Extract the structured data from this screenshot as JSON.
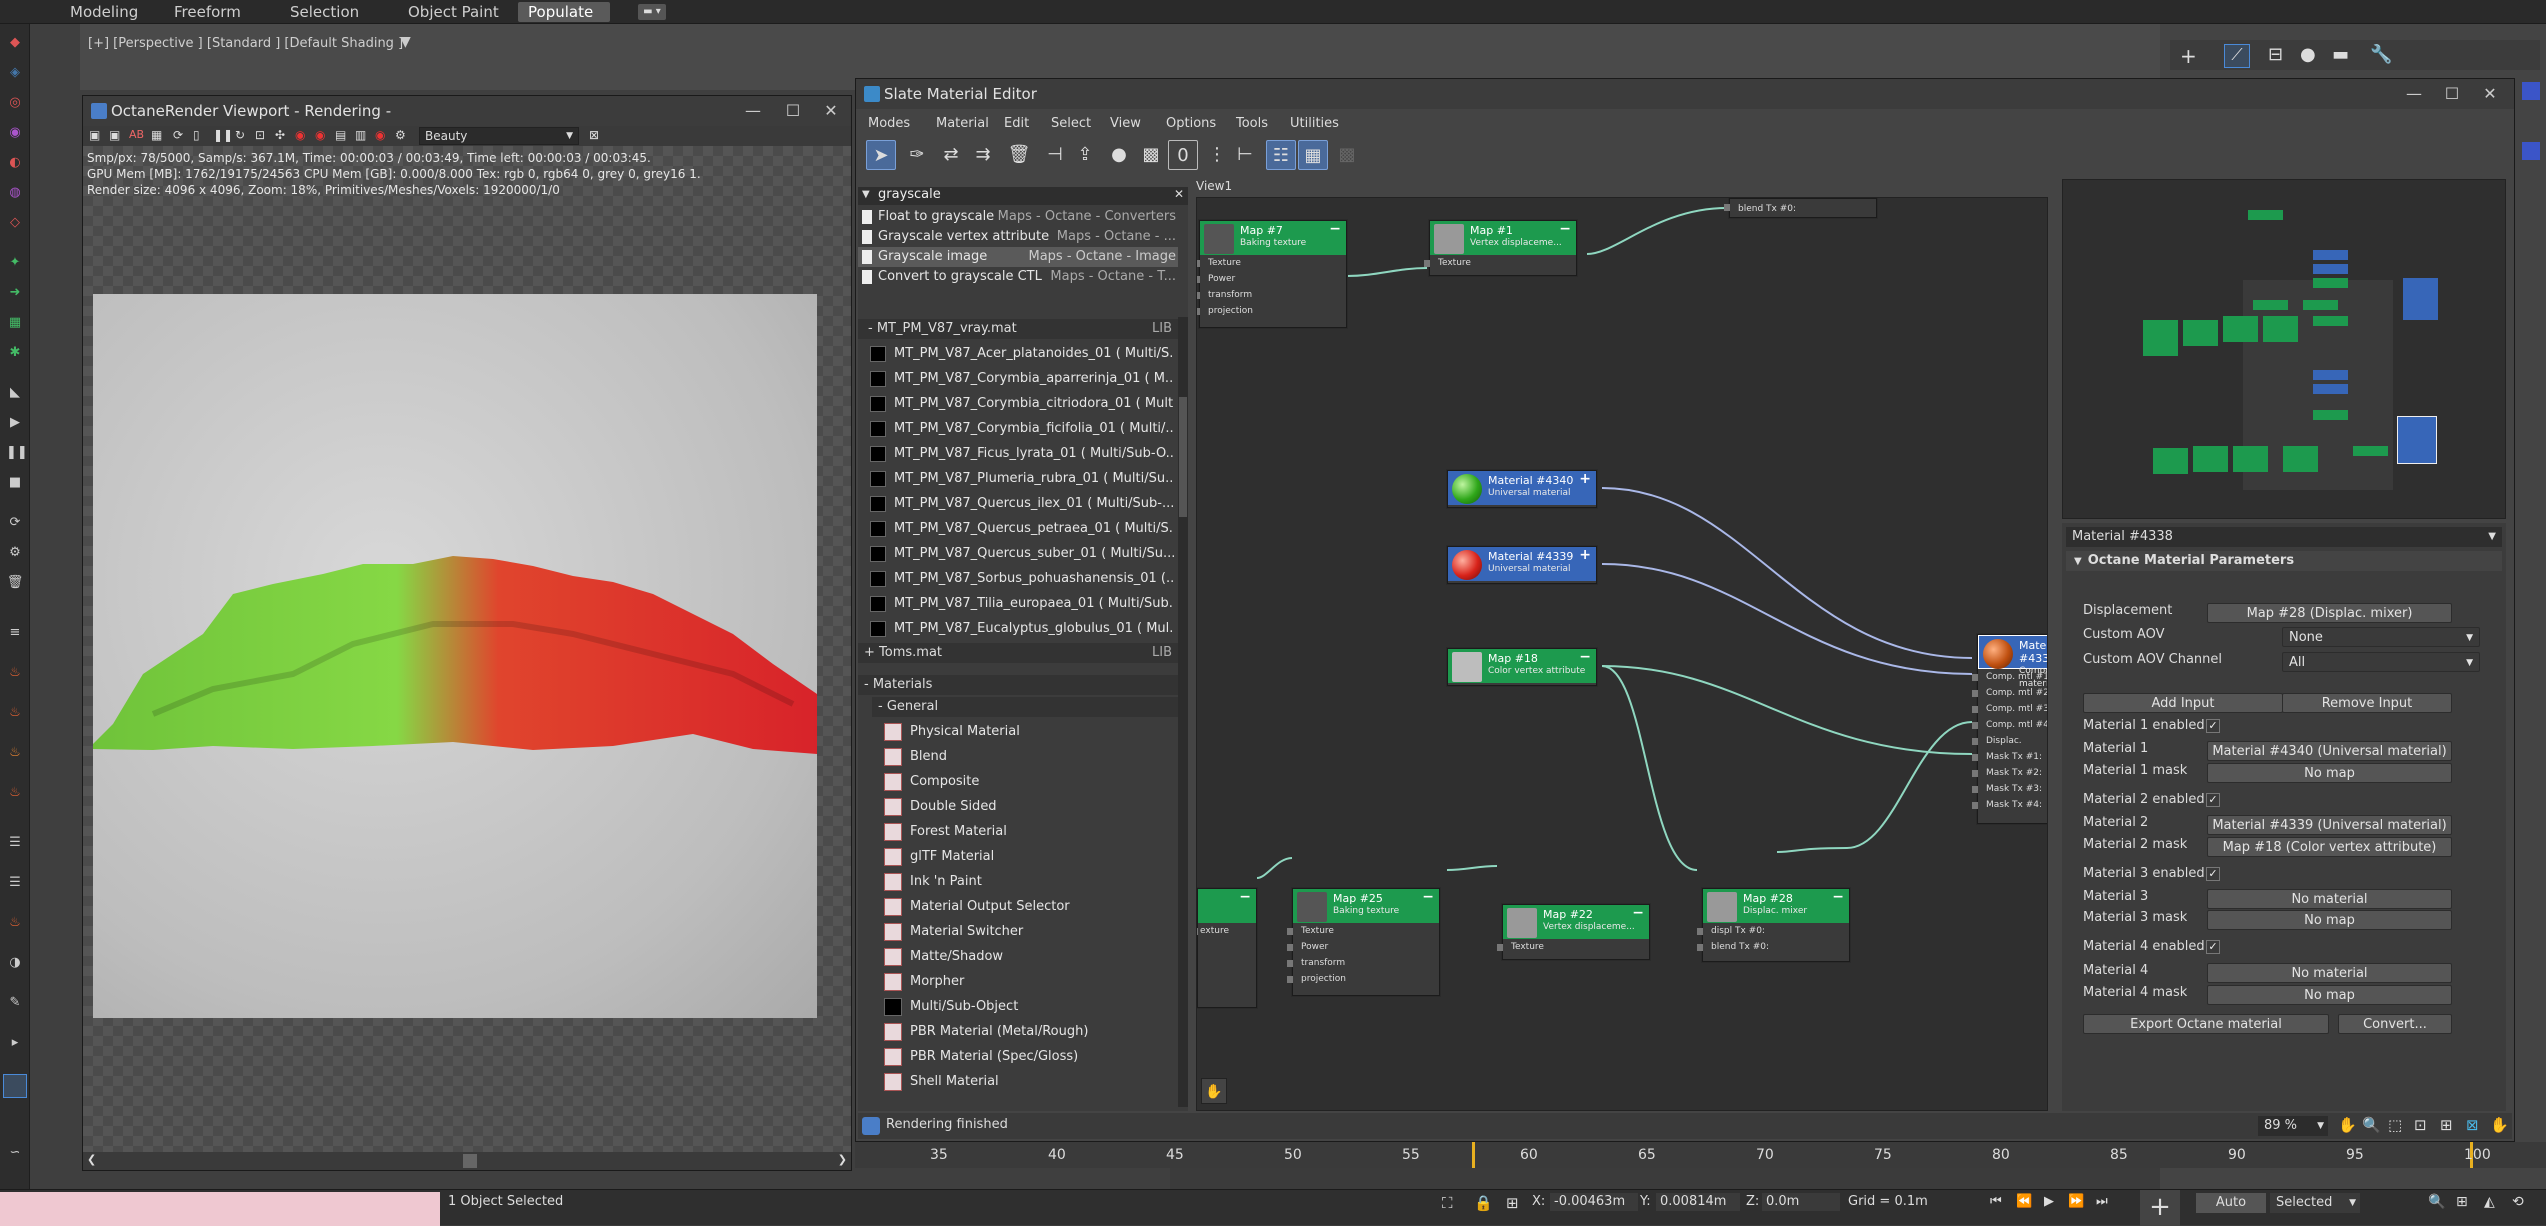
{
  "ribbon": {
    "tabs": [
      "Modeling",
      "Freeform",
      "Selection",
      "Object Paint",
      "Populate"
    ],
    "active": "Populate"
  },
  "viewport": {
    "label": "[+] [Perspective ] [Standard ] [Default Shading ]"
  },
  "octane": {
    "title": "OctaneRender Viewport - Rendering -",
    "pass": "Beauty",
    "stats": [
      "Smp/px: 78/5000,  Samp/s: 367.1M,  Time: 00:00:03 / 00:03:49,  Time left: 00:00:03 / 00:03:45.",
      "GPU Mem [MB]: 1762/19175/24563   CPU Mem [GB]: 0.000/8.000   Tex: rgb 0, rgb64 0, grey 0, grey16 1.",
      "Render size: 4096 x 4096,  Zoom: 18%,  Primitives/Meshes/Voxels: 1920000/1/0"
    ]
  },
  "sme": {
    "title": "Slate Material Editor",
    "menu": [
      "Modes",
      "Material",
      "Edit",
      "Select",
      "View",
      "Options",
      "Tools",
      "Utilities"
    ],
    "search": "grayscale",
    "search_results": [
      {
        "name": "Float to grayscale",
        "cat": "Maps - Octane - Converters"
      },
      {
        "name": "Grayscale vertex attribute",
        "cat": "Maps - Octane - ..."
      },
      {
        "name": "Grayscale image",
        "cat": "Maps - Octane - Image"
      },
      {
        "name": "Convert to grayscale CTL",
        "cat": "Maps - Octane - T..."
      }
    ],
    "lib_header": "- MT_PM_V87_vray.mat",
    "lib_tag": "LIB",
    "lib_items": [
      "MT_PM_V87_Acer_platanoides_01   ( Multi/S...",
      "MT_PM_V87_Corymbia_aparrerinja_01   ( M...",
      "MT_PM_V87_Corymbia_citriodora_01   ( Mult...",
      "MT_PM_V87_Corymbia_ficifolia_01   ( Multi/...",
      "MT_PM_V87_Ficus_lyrata_01   ( Multi/Sub-O...",
      "MT_PM_V87_Plumeria_rubra_01   ( Multi/Su...",
      "MT_PM_V87_Quercus_ilex_01   ( Multi/Sub-...",
      "MT_PM_V87_Quercus_petraea_01   ( Multi/S...",
      "MT_PM_V87_Quercus_suber_01   ( Multi/Su...",
      "MT_PM_V87_Sorbus_pohuashanensis_01   (...",
      "MT_PM_V87_Tilia_europaea_01   ( Multi/Sub...",
      "MT_PM_V87_Eucalyptus_globulus_01   ( Mul..."
    ],
    "toms": "+ Toms.mat",
    "materials_header": "- Materials",
    "general_header": "- General",
    "general_items": [
      "Physical Material",
      "Blend",
      "Composite",
      "Double Sided",
      "Forest Material",
      "glTF Material",
      "Ink 'n Paint",
      "Material Output Selector",
      "Material Switcher",
      "Matte/Shadow",
      "Morpher",
      "Multi/Sub-Object",
      "PBR Material (Metal/Rough)",
      "PBR Material (Spec/Gloss)",
      "Shell Material"
    ],
    "view_tab": "View1",
    "status": "Rendering finished",
    "zoom": "89 %",
    "nodes": {
      "map7": {
        "title": "Map #7",
        "sub": "Baking texture",
        "slots": [
          "Texture",
          "Power",
          "transform",
          "projection"
        ]
      },
      "map1": {
        "title": "Map #1",
        "sub": "Vertex displaceme...",
        "slots": [
          "Texture"
        ]
      },
      "top_partial": {
        "slot": "blend Tx #0:"
      },
      "mat4340": {
        "title": "Material #4340",
        "sub": "Universal material"
      },
      "mat4339": {
        "title": "Material #4339",
        "sub": "Universal material"
      },
      "map18": {
        "title": "Map #18",
        "sub": "Color vertex attribute"
      },
      "mat4338": {
        "title": "Material #4338",
        "sub": "Composite materi...",
        "slots": [
          "Comp. mtl #1",
          "Comp. mtl #2",
          "Comp. mtl #3",
          "Comp. mtl #4",
          "Displac.",
          "Mask Tx #1:",
          "Mask Tx #2:",
          "Mask Tx #3:",
          "Mask Tx #4:"
        ]
      },
      "left_partial": {
        "slot": "exture"
      },
      "map25": {
        "title": "Map #25",
        "sub": "Baking texture",
        "slots": [
          "Texture",
          "Power",
          "transform",
          "projection"
        ]
      },
      "map22": {
        "title": "Map #22",
        "sub": "Vertex displaceme...",
        "slots": [
          "Texture"
        ]
      },
      "map28": {
        "title": "Map #28",
        "sub": "Displac. mixer",
        "slots": [
          "displ Tx #0:",
          "blend Tx #0:"
        ]
      }
    },
    "params": {
      "material": "Material #4338",
      "section": "Octane Material Parameters",
      "displacement_label": "Displacement",
      "displacement_value": "Map #28 (Displac. mixer)",
      "custom_aov_label": "Custom AOV",
      "custom_aov_value": "None",
      "custom_aov_channel_label": "Custom AOV Channel",
      "custom_aov_channel_value": "All",
      "add_input": "Add Input",
      "remove_input": "Remove Input",
      "rows": [
        {
          "label": "Material 1 enabled",
          "type": "check"
        },
        {
          "label": "Material 1",
          "value": "Material #4340 (Universal material)"
        },
        {
          "label": "Material 1 mask",
          "value": "No map"
        },
        {
          "label": "Material 2 enabled",
          "type": "check"
        },
        {
          "label": "Material 2",
          "value": "Material #4339 (Universal material)"
        },
        {
          "label": "Material 2 mask",
          "value": "Map #18 (Color vertex attribute)"
        },
        {
          "label": "Material 3 enabled",
          "type": "check"
        },
        {
          "label": "Material 3",
          "value": "No material"
        },
        {
          "label": "Material 3 mask",
          "value": "No map"
        },
        {
          "label": "Material 4 enabled",
          "type": "check"
        },
        {
          "label": "Material 4",
          "value": "No material"
        },
        {
          "label": "Material 4 mask",
          "value": "No map"
        }
      ],
      "export": "Export Octane material",
      "convert": "Convert..."
    }
  },
  "timeline": {
    "ticks": [
      "35",
      "40",
      "45",
      "50",
      "55",
      "60",
      "65",
      "70",
      "75",
      "80",
      "85",
      "90",
      "95",
      "100"
    ]
  },
  "statusbar": {
    "selection": "1 Object Selected",
    "x_label": "X:",
    "x": "-0.00463m",
    "y_label": "Y:",
    "y": "0.00814m",
    "z_label": "Z:",
    "z": "0.0m",
    "grid": "Grid = 0.1m",
    "auto": "Auto",
    "selected": "Selected"
  },
  "colors": {
    "node_green": "#1d9a4e",
    "node_blue": "#3766b8",
    "wire": "#8fd7c0",
    "wire_blue": "#aab8e8"
  }
}
